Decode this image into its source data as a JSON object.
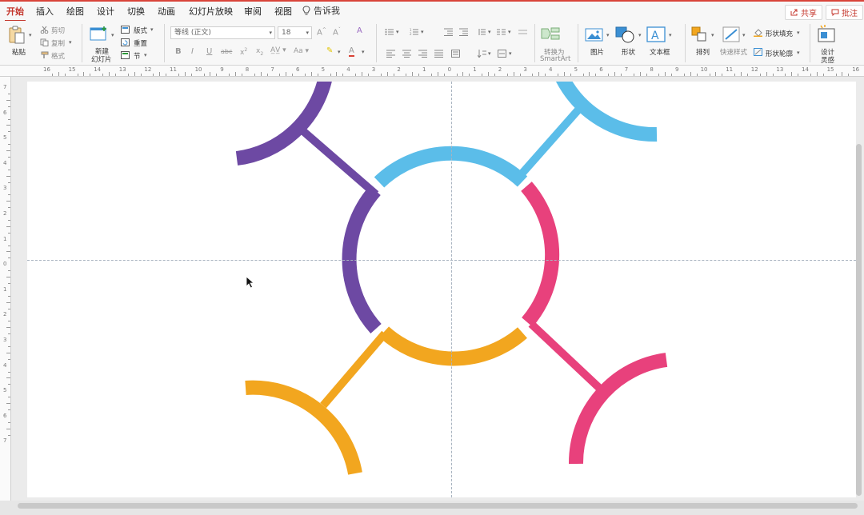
{
  "tabs": [
    {
      "label": "开始",
      "active": true
    },
    {
      "label": "插入"
    },
    {
      "label": "绘图"
    },
    {
      "label": "设计"
    },
    {
      "label": "切换"
    },
    {
      "label": "动画"
    },
    {
      "label": "幻灯片放映"
    },
    {
      "label": "审阅"
    },
    {
      "label": "视图"
    }
  ],
  "tellme": "告诉我",
  "share_label": "共享",
  "comment_label": "批注",
  "ribbon": {
    "paste": "粘贴",
    "cut": "剪切",
    "copy": "复制",
    "format_painter": "格式",
    "new_slide": "新建\n幻灯片",
    "new_slide_line1": "新建",
    "new_slide_line2": "幻灯片",
    "layout": "版式",
    "reset": "重置",
    "section": "节",
    "font_name": "等线 (正文)",
    "font_size": "18",
    "convert_smartart_line1": "转换为",
    "convert_smartart_line2": "SmartArt",
    "picture": "图片",
    "shape": "形状",
    "textbox": "文本框",
    "arrange": "排列",
    "quick_styles": "快速样式",
    "shape_fill": "形状填充",
    "shape_outline": "形状轮廓",
    "design_ideas_line1": "设计",
    "design_ideas_line2": "灵感"
  },
  "ruler_h_labels": [
    "16",
    "15",
    "14",
    "13",
    "12",
    "11",
    "10",
    "9",
    "8",
    "7",
    "6",
    "5",
    "4",
    "3",
    "2",
    "1",
    "0",
    "1",
    "2",
    "3",
    "4",
    "5",
    "6",
    "7",
    "8",
    "9",
    "10",
    "11",
    "12",
    "13",
    "14",
    "15",
    "16"
  ],
  "ruler_v_labels": [
    "7",
    "6",
    "5",
    "4",
    "3",
    "2",
    "1",
    "0",
    "1",
    "2",
    "3",
    "4",
    "5",
    "6",
    "7"
  ],
  "colors": {
    "purple": "#6d49a3",
    "blue": "#5bbde9",
    "pink": "#e8417c",
    "orange": "#f2a61f",
    "accent": "#c4372d"
  },
  "icons": [
    "paste-icon",
    "cut-icon",
    "copy-icon",
    "format-painter-icon",
    "new-slide-icon",
    "layout-icon",
    "reset-icon",
    "section-icon",
    "bold-icon",
    "italic-icon",
    "underline-icon",
    "strikethrough-icon",
    "superscript-icon",
    "subscript-icon",
    "highlight-icon",
    "font-color-icon",
    "bullets-icon",
    "numbering-icon",
    "align-left-icon",
    "center-icon",
    "align-right-icon",
    "justify-icon",
    "smartart-icon",
    "picture-icon",
    "shape-icon",
    "textbox-icon",
    "arrange-icon",
    "quick-styles-icon",
    "fill-icon",
    "outline-icon",
    "design-ideas-icon",
    "lightbulb-icon",
    "mouse-cursor-icon"
  ]
}
